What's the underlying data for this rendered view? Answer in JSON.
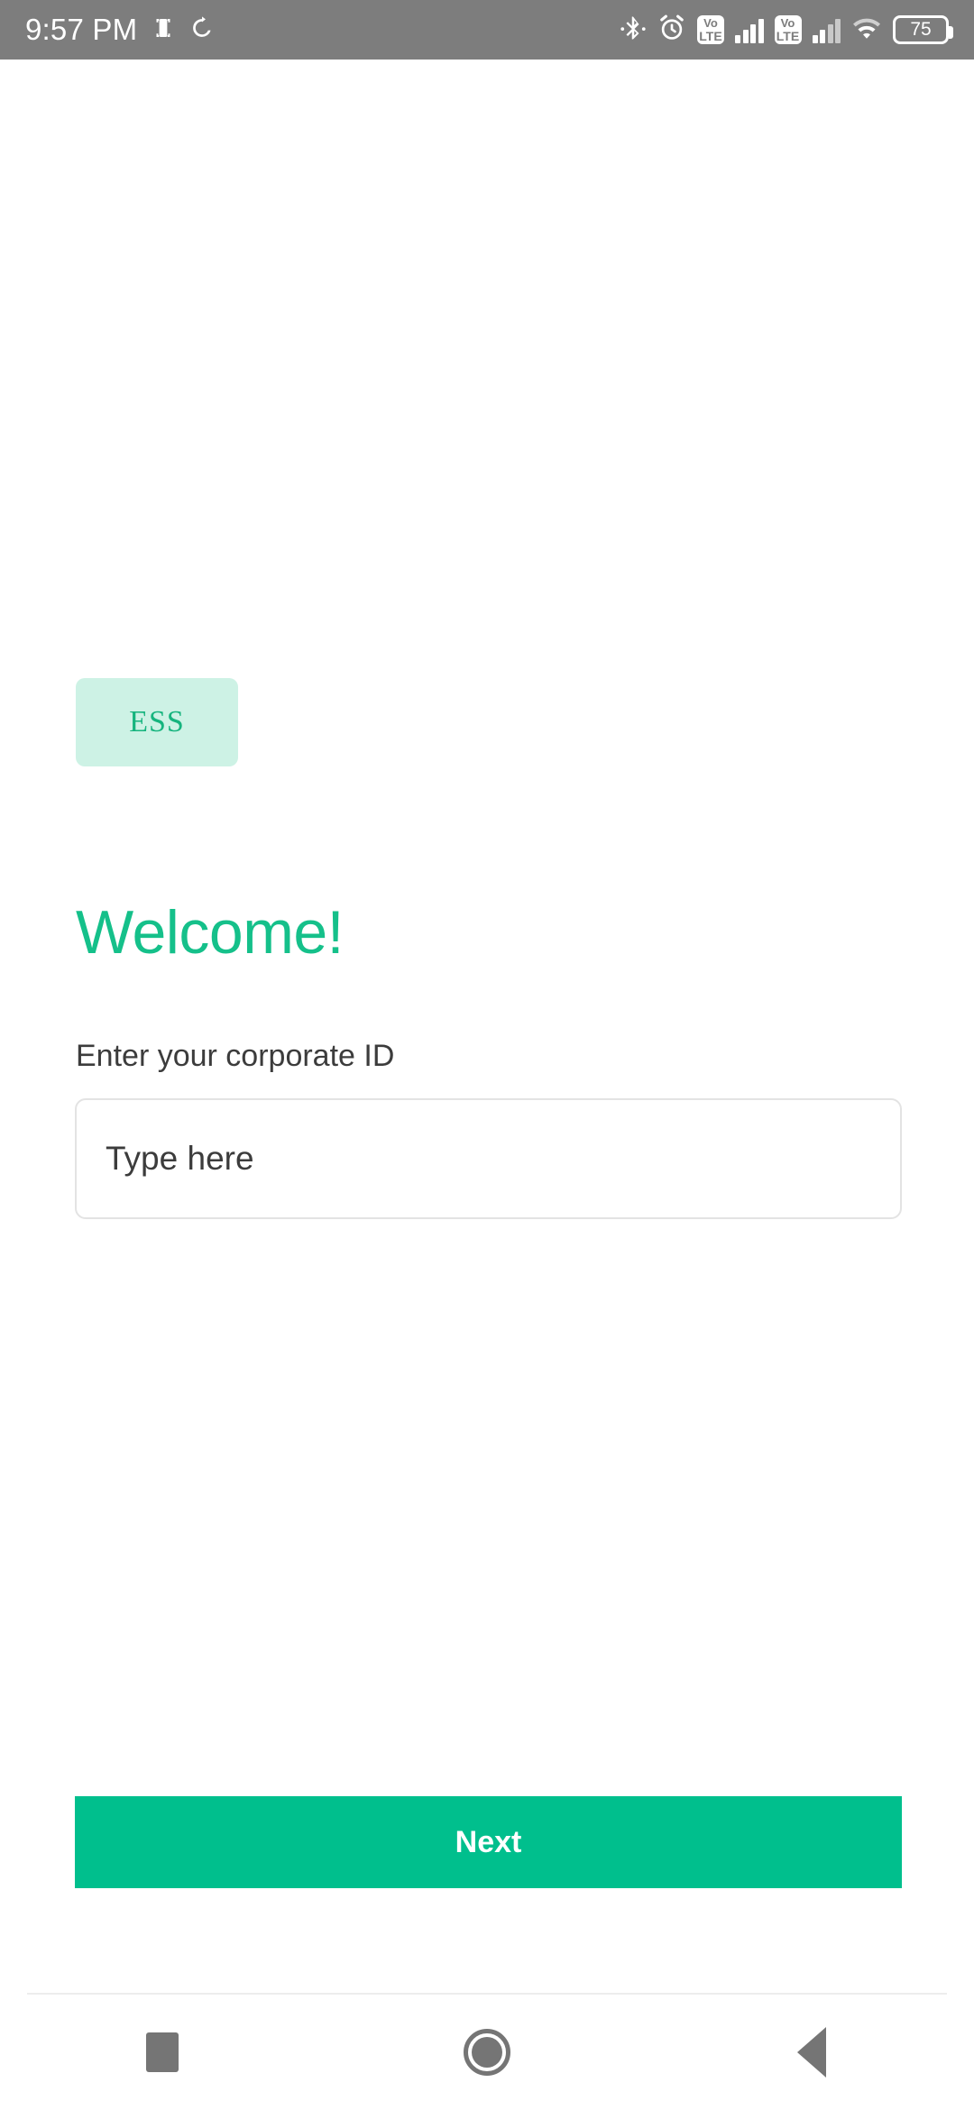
{
  "status_bar": {
    "time": "9:57 PM",
    "icons_left": [
      "screenshot-icon",
      "sync-icon"
    ],
    "bluetooth": "bluetooth-icon",
    "alarm": "alarm-icon",
    "network_label_1": {
      "top": "Vo",
      "bottom": "LTE"
    },
    "network_label_2": {
      "top": "Vo",
      "bottom": "LTE"
    },
    "wifi": "wifi-icon",
    "battery_percent": "75",
    "background_color": "#7d7d7d"
  },
  "brand": {
    "logo_text": "ESS",
    "logo_bg": "#cdf2e5",
    "logo_text_color": "#16b47e"
  },
  "main": {
    "heading": "Welcome!",
    "heading_color": "#15c08a",
    "field_label": "Enter your corporate ID",
    "input_value": "",
    "input_placeholder": "Type here",
    "next_label": "Next",
    "accent_color": "#00bf8d"
  },
  "nav_bar": {
    "recents": "square-icon",
    "home": "circle-icon",
    "back": "triangle-back-icon"
  }
}
